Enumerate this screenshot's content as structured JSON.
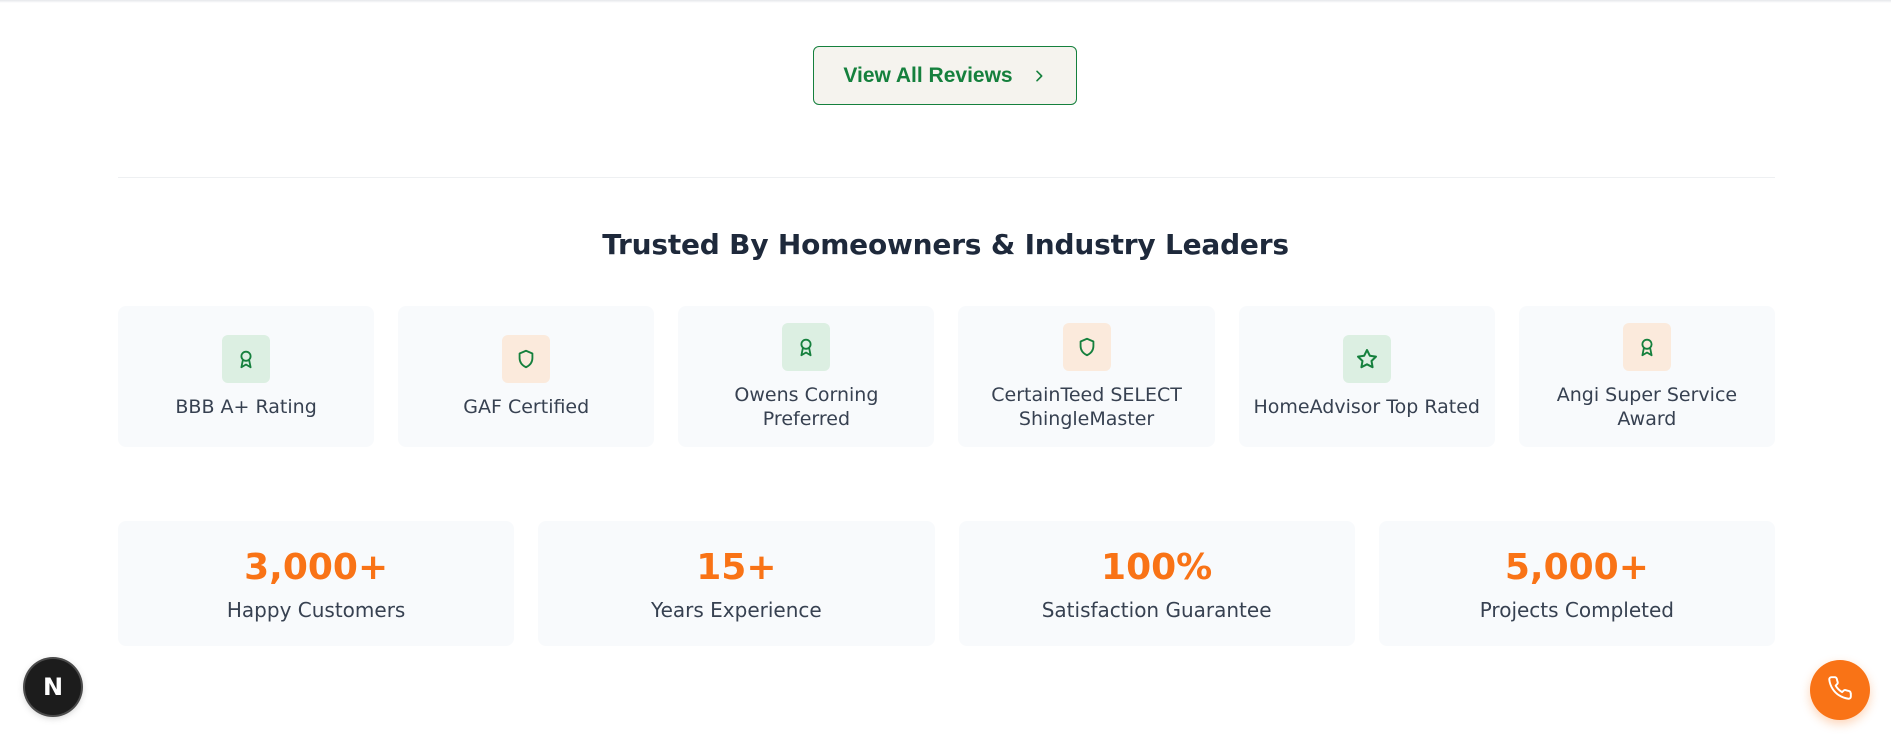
{
  "reviews": {
    "view_all_label": "View All Reviews",
    "icon": "chevron-right-icon"
  },
  "trust": {
    "title": "Trusted By Homeowners & Industry Leaders",
    "badges": [
      {
        "label": "BBB A+ Rating",
        "icon": "award-icon",
        "icon_bg": "#dcefe2"
      },
      {
        "label": "GAF Certified",
        "icon": "shield-icon",
        "icon_bg": "#fbeadc"
      },
      {
        "label": "Owens Corning Preferred",
        "icon": "award-icon",
        "icon_bg": "#dcefe2"
      },
      {
        "label": "CertainTeed SELECT ShingleMaster",
        "icon": "shield-icon",
        "icon_bg": "#fbeadc"
      },
      {
        "label": "HomeAdvisor Top Rated",
        "icon": "star-icon",
        "icon_bg": "#dcefe2"
      },
      {
        "label": "Angi Super Service Award",
        "icon": "award-icon",
        "icon_bg": "#fbeadc"
      }
    ]
  },
  "stats": [
    {
      "value": "3,000+",
      "label": "Happy Customers"
    },
    {
      "value": "15+",
      "label": "Years Experience"
    },
    {
      "value": "100%",
      "label": "Satisfaction Guarantee"
    },
    {
      "value": "5,000+",
      "label": "Projects Completed"
    }
  ],
  "floating": {
    "dev_badge_letter": "N",
    "phone_icon": "phone-icon"
  },
  "colors": {
    "brand_green": "#15803d",
    "accent_orange": "#f97316",
    "card_bg": "#f8fafc"
  }
}
